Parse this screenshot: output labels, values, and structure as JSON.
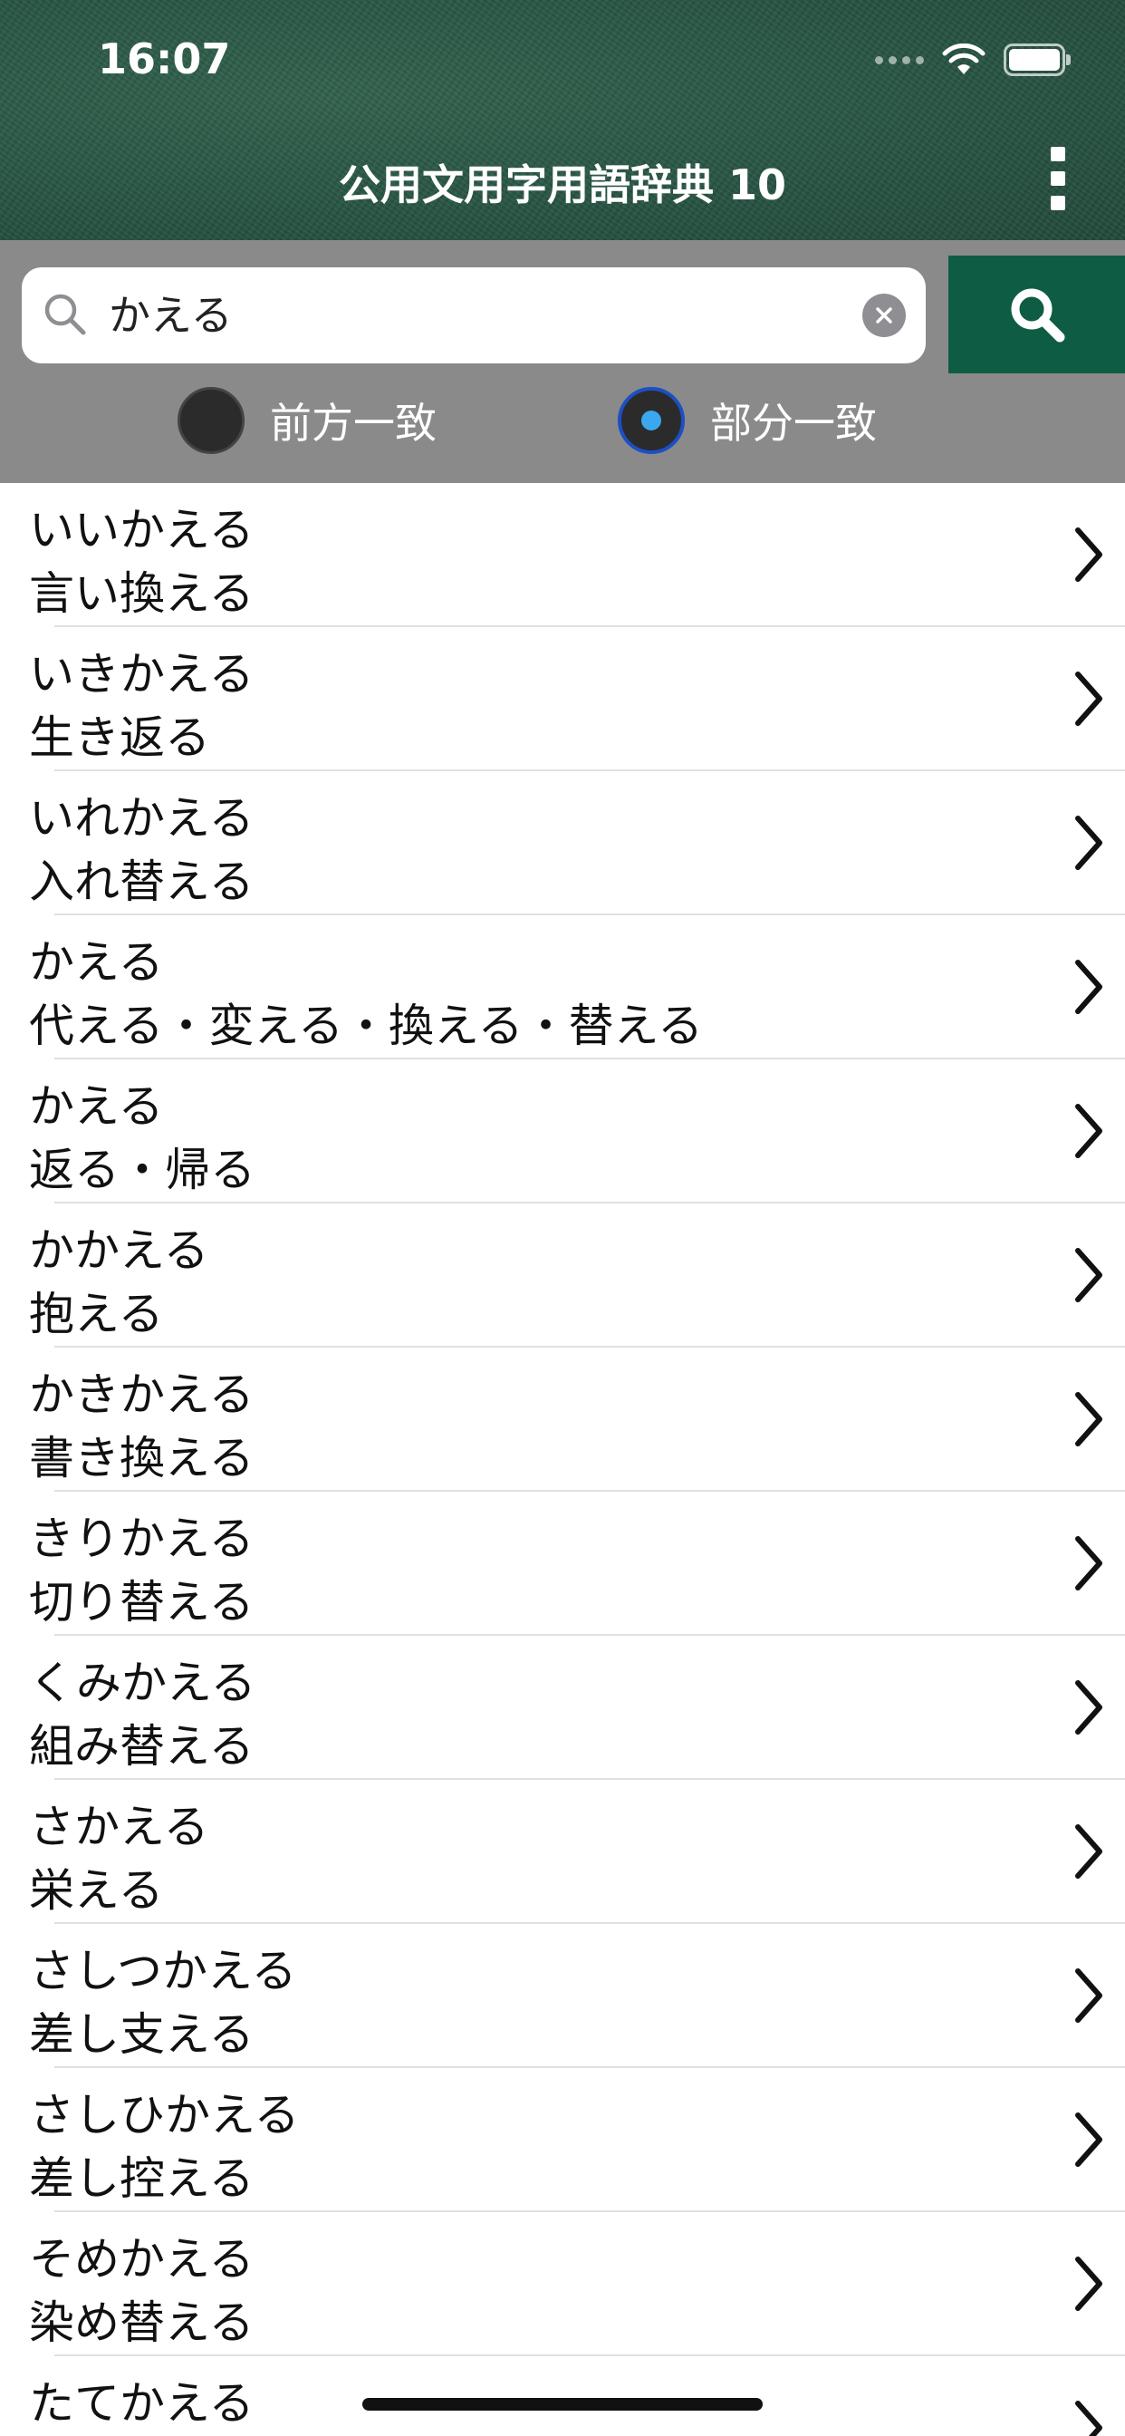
{
  "status_bar": {
    "time": "16:07"
  },
  "header": {
    "title": "公用文用字用語辞典 10"
  },
  "search": {
    "query": "かえる",
    "modes": [
      {
        "label": "前方一致",
        "selected": false
      },
      {
        "label": "部分一致",
        "selected": true
      }
    ]
  },
  "colors": {
    "header_green": "#2b5a47",
    "search_button": "#0e5c44",
    "search_bar_bg": "#8a8a8a",
    "radio_selected": "#3aa7ef"
  },
  "results": [
    {
      "reading": "いいかえる",
      "kanji": "言い換える"
    },
    {
      "reading": "いきかえる",
      "kanji": "生き返る"
    },
    {
      "reading": "いれかえる",
      "kanji": "入れ替える"
    },
    {
      "reading": "かえる",
      "kanji": "代える・変える・換える・替える"
    },
    {
      "reading": "かえる",
      "kanji": "返る・帰る"
    },
    {
      "reading": "かかえる",
      "kanji": "抱える"
    },
    {
      "reading": "かきかえる",
      "kanji": "書き換える"
    },
    {
      "reading": "きりかえる",
      "kanji": "切り替える"
    },
    {
      "reading": "くみかえる",
      "kanji": "組み替える"
    },
    {
      "reading": "さかえる",
      "kanji": "栄える"
    },
    {
      "reading": "さしつかえる",
      "kanji": "差し支える"
    },
    {
      "reading": "さしひかえる",
      "kanji": "差し控える"
    },
    {
      "reading": "そめかえる",
      "kanji": "染め替える"
    },
    {
      "reading": "たてかえる",
      "kanji": ""
    }
  ]
}
